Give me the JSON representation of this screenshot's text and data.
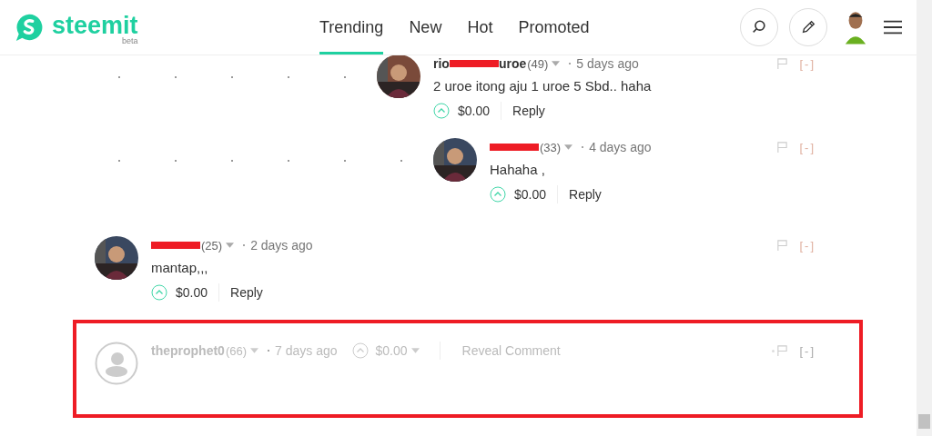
{
  "header": {
    "logo": "steemit",
    "logo_badge": "beta",
    "tabs": [
      {
        "label": "Trending",
        "selected": true
      },
      {
        "label": "New",
        "selected": false
      },
      {
        "label": "Hot",
        "selected": false
      },
      {
        "label": "Promoted",
        "selected": false
      }
    ]
  },
  "comments": [
    {
      "kind": "deep",
      "author_start": "rio",
      "author_end": "uroe",
      "redacted": true,
      "reputation": "(49)",
      "time": "5 days ago",
      "body": "2 uroe itong aju 1 uroe 5 Sbd.. haha",
      "payout": "$0.00",
      "reply": "Reply",
      "collapse": "[-]",
      "children": [
        {
          "redacted": true,
          "reputation": "(33)",
          "time": "4 days ago",
          "body": "Hahaha ,",
          "payout": "$0.00",
          "reply": "Reply",
          "collapse": "[-]"
        }
      ]
    },
    {
      "kind": "top",
      "redacted": true,
      "reputation": "(25)",
      "time": "2 days ago",
      "body": "mantap,,,",
      "payout": "$0.00",
      "reply": "Reply",
      "collapse": "[-]"
    },
    {
      "kind": "hidden",
      "author_start": "theprophet0",
      "redacted": false,
      "reputation": "(66)",
      "time": "7 days ago",
      "payout": "$0.00",
      "reveal": "Reveal Comment",
      "collapse": "[-]",
      "highlighted": true
    }
  ]
}
